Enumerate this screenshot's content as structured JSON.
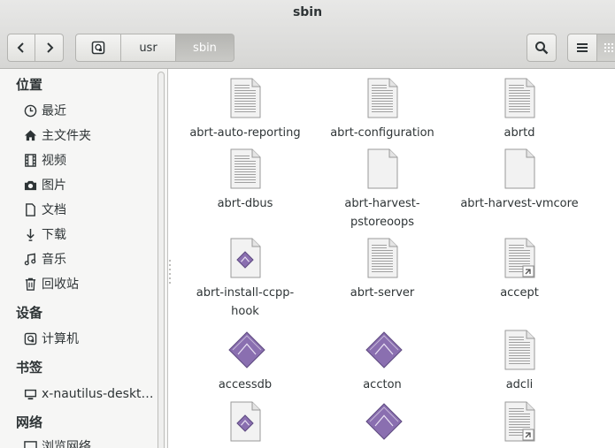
{
  "window": {
    "title": "sbin"
  },
  "path": {
    "home_icon": "home-drive-icon",
    "crumbs": [
      "usr",
      "sbin"
    ]
  },
  "sidebar": {
    "sections": [
      {
        "label": "位置"
      },
      {
        "label": "设备"
      },
      {
        "label": "书签"
      },
      {
        "label": "网络"
      }
    ],
    "places": [
      "最近",
      "主文件夹",
      "视频",
      "图片",
      "文档",
      "下载",
      "音乐",
      "回收站"
    ],
    "devices": [
      "计算机"
    ],
    "bookmarks": [
      "x-nautilus-deskt…"
    ],
    "network": [
      "浏览网络"
    ]
  },
  "files": [
    {
      "name": "abrt-auto-reporting",
      "type": "text"
    },
    {
      "name": "abrt-configuration",
      "type": "text"
    },
    {
      "name": "abrtd",
      "type": "text"
    },
    {
      "name": "abrt-dbus",
      "type": "text"
    },
    {
      "name": "abrt-harvest-\npstoreoops",
      "type": "blank"
    },
    {
      "name": "abrt-harvest-vmcore",
      "type": "blank"
    },
    {
      "name": "abrt-install-ccpp-\nhook",
      "type": "diamond-doc"
    },
    {
      "name": "abrt-server",
      "type": "text"
    },
    {
      "name": "accept",
      "type": "link"
    },
    {
      "name": "accessdb",
      "type": "diamond"
    },
    {
      "name": "accton",
      "type": "diamond"
    },
    {
      "name": "adcli",
      "type": "text"
    },
    {
      "name": "",
      "type": "diamond-doc"
    },
    {
      "name": "",
      "type": "diamond"
    },
    {
      "name": "",
      "type": "link"
    }
  ],
  "colors": {
    "header": "#dcdcda",
    "sidebar": "#f6f6f5",
    "active_crumb": "#bdbdba",
    "diamond": "#8a6fb0"
  }
}
